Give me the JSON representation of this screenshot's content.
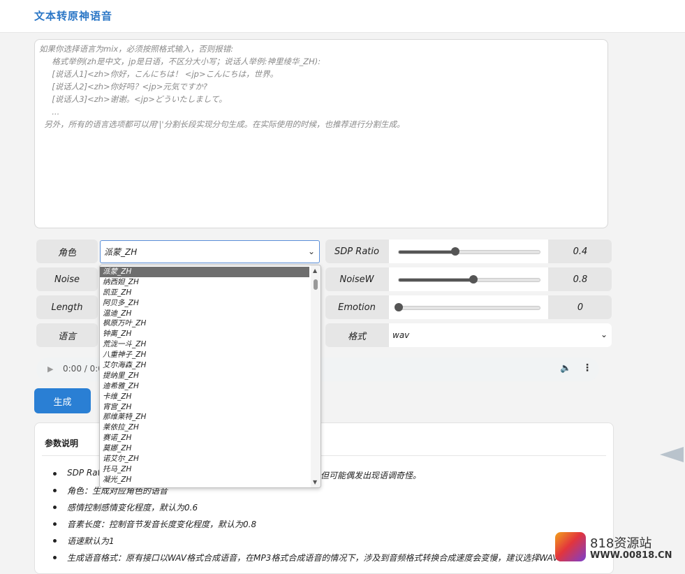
{
  "app": {
    "title": "文本转原神语音"
  },
  "text_input": {
    "value": "如果你选择语言为mix，必须按照格式输入，否则报错:\n     格式举例(zh是中文，jp是日语，不区分大小写；说话人举例:神里绫华_ZH):\n     [说话人1]<zh>你好，こんにちは！ <jp>こんにちは，世界。\n     [说话人2]<zh>你好吗？<jp>元気ですか?\n     [说话人3]<zh>谢谢。<jp>どういたしまして。\n     ...\n  另外，所有的语言选项都可以用'|'分割长段实现分句生成。在实际使用的时候，也推荐进行分割生成。"
  },
  "left_labels": {
    "role": "角色",
    "noise": "Noise",
    "length": "Length",
    "language": "语言"
  },
  "role_select": {
    "value": "派蒙_ZH"
  },
  "dropdown": {
    "options": [
      "派蒙_ZH",
      "纳西妲_ZH",
      "凯亚_ZH",
      "阿贝多_ZH",
      "温迪_ZH",
      "枫原万叶_ZH",
      "钟离_ZH",
      "荒泷一斗_ZH",
      "八重神子_ZH",
      "艾尔海森_ZH",
      "提纳里_ZH",
      "迪希雅_ZH",
      "卡维_ZH",
      "宵宫_ZH",
      "那维莱特_ZH",
      "莱依拉_ZH",
      "赛诺_ZH",
      "莫娜_ZH",
      "诺艾尔_ZH",
      "托马_ZH",
      "凝光_ZH"
    ]
  },
  "sliders": {
    "sdp": {
      "label": "SDP Ratio",
      "value": "0.4",
      "fraction": 0.4
    },
    "noisew": {
      "label": "NoiseW",
      "value": "0.8",
      "fraction": 0.53
    },
    "emotion": {
      "label": "Emotion",
      "value": "0",
      "fraction": 0.0
    }
  },
  "format": {
    "label": "格式",
    "value": "wav"
  },
  "audio": {
    "time": "0:00 / 0:0"
  },
  "generate_button": {
    "label": "生成"
  },
  "params": {
    "title": "参数说明",
    "items": [
      "SDP Ratio",
      "角色：生成对应角色的语音",
      "感情控制感情变化程度，默认为0.6",
      "音素长度：控制音节发音长度变化程度，默认为0.8",
      "语速默认为1",
      "生成语音格式：原有接口以WAV格式合成语音，在MP3格式合成语音的情况下，涉及到音频格式转换合成速度会变慢，建议选择WAV格式"
    ],
    "partial_tail": "但可能偶发出现语调奇怪。"
  },
  "watermark": {
    "name": "818资源站",
    "url": "WWW.00818.CN"
  }
}
